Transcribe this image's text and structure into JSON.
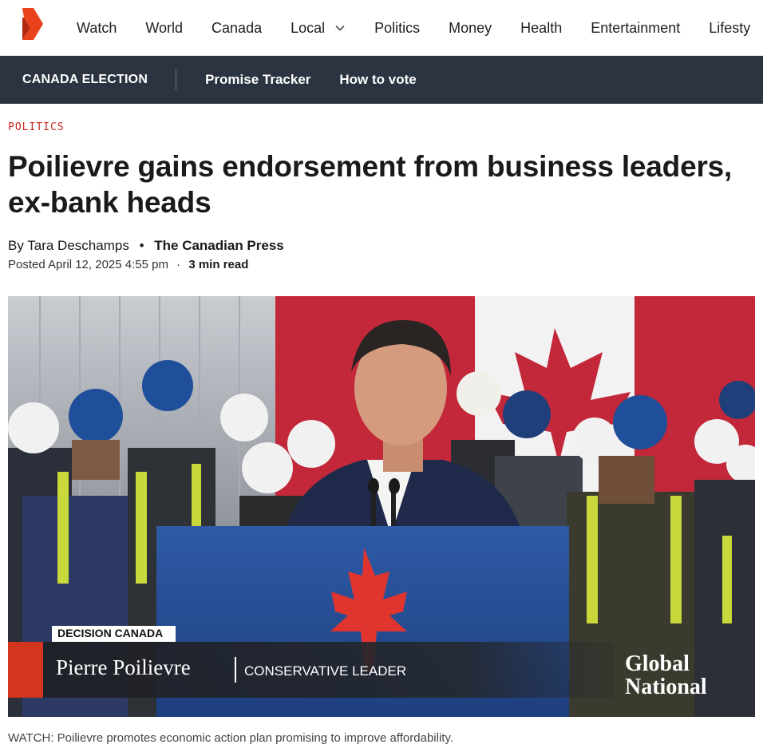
{
  "nav": {
    "items": [
      "Watch",
      "World",
      "Canada",
      "Local",
      "Politics",
      "Money",
      "Health",
      "Entertainment",
      "Lifesty"
    ]
  },
  "subnav": {
    "section": "CANADA ELECTION",
    "links": [
      "Promise Tracker",
      "How to vote"
    ]
  },
  "article": {
    "category": "POLITICS",
    "headline": "Poilievre gains endorsement from business leaders, ex-bank heads",
    "by_prefix": "By",
    "author": "Tara Deschamps",
    "separator": "•",
    "source": "The Canadian Press",
    "posted": "Posted April 12, 2025 4:55 pm",
    "posted_sep": "·",
    "read_time": "3 min read"
  },
  "video": {
    "lower_third_tag": "DECISION CANADA",
    "speaker_name": "Pierre Poilievre",
    "speaker_title": "CONSERVATIVE LEADER",
    "network_line1": "Global",
    "network_line2": "National"
  },
  "caption": "WATCH: Poilievre promotes economic action plan promising to improve affordability.",
  "colors": {
    "brand": "#e8431b",
    "subnav_bg": "#2c3441",
    "category": "#c8281e"
  }
}
